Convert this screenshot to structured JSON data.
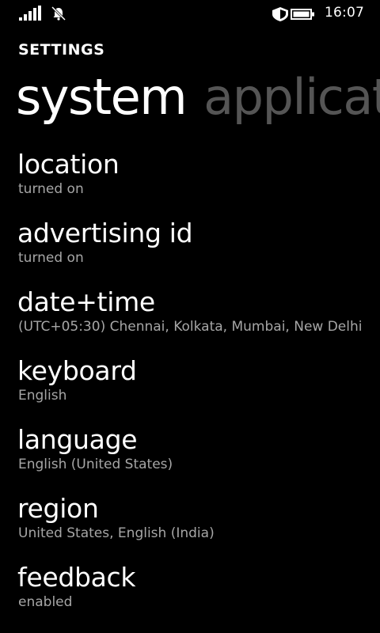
{
  "status_bar": {
    "time": "16:07",
    "icons": [
      "signal-icon",
      "quiet-hours-bell-icon",
      "battery-saver-icon"
    ]
  },
  "app": {
    "title": "SETTINGS"
  },
  "pivot": {
    "active": "system",
    "next": "applicat"
  },
  "items": [
    {
      "title": "location",
      "subtitle": "turned on"
    },
    {
      "title": "advertising id",
      "subtitle": "turned on"
    },
    {
      "title": "date+time",
      "subtitle": "(UTC+05:30) Chennai, Kolkata, Mumbai, New Delhi"
    },
    {
      "title": "keyboard",
      "subtitle": "English"
    },
    {
      "title": "language",
      "subtitle": "English (United States)"
    },
    {
      "title": "region",
      "subtitle": "United States, English (India)"
    },
    {
      "title": "feedback",
      "subtitle": "enabled"
    }
  ],
  "colors": {
    "background": "#000000",
    "text": "#ffffff",
    "subtext": "#a6a6a6",
    "inactive_pivot": "#555555"
  }
}
